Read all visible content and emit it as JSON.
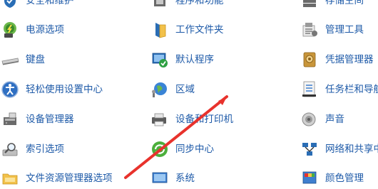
{
  "columns": [
    [
      {
        "label": "安全和维护",
        "icon": "security-maintenance-icon"
      },
      {
        "label": "电源选项",
        "icon": "power-options-icon"
      },
      {
        "label": "键盘",
        "icon": "keyboard-icon"
      },
      {
        "label": "轻松使用设置中心",
        "icon": "ease-of-access-icon"
      },
      {
        "label": "设备管理器",
        "icon": "device-manager-icon"
      },
      {
        "label": "索引选项",
        "icon": "indexing-options-icon"
      },
      {
        "label": "文件资源管理器选项",
        "icon": "file-explorer-options-icon"
      }
    ],
    [
      {
        "label": "程序和功能",
        "icon": "programs-features-icon"
      },
      {
        "label": "工作文件夹",
        "icon": "work-folders-icon"
      },
      {
        "label": "默认程序",
        "icon": "default-programs-icon"
      },
      {
        "label": "区域",
        "icon": "region-icon"
      },
      {
        "label": "设备和打印机",
        "icon": "devices-printers-icon"
      },
      {
        "label": "同步中心",
        "icon": "sync-center-icon"
      },
      {
        "label": "系统",
        "icon": "system-icon"
      }
    ],
    [
      {
        "label": "存储空间",
        "icon": "storage-spaces-icon"
      },
      {
        "label": "管理工具",
        "icon": "admin-tools-icon"
      },
      {
        "label": "凭据管理器",
        "icon": "credential-manager-icon"
      },
      {
        "label": "任务栏和导航",
        "icon": "taskbar-navigation-icon"
      },
      {
        "label": "声音",
        "icon": "sound-icon"
      },
      {
        "label": "网络和共享中心",
        "icon": "network-sharing-icon"
      },
      {
        "label": "颜色管理",
        "icon": "color-management-icon"
      }
    ]
  ],
  "colors": {
    "link": "#1e5aa8",
    "arrow": "#e8322c"
  }
}
